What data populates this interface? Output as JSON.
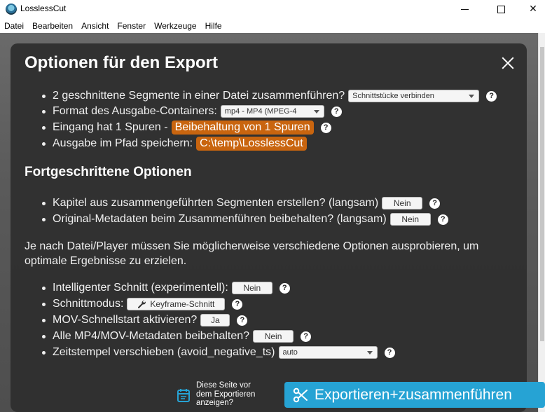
{
  "app": {
    "title": "LosslessCut"
  },
  "window_controls": {
    "minimize": "",
    "maximize": "",
    "close": "✕"
  },
  "menu": [
    "Datei",
    "Bearbeiten",
    "Ansicht",
    "Fenster",
    "Werkzeuge",
    "Hilfe"
  ],
  "dialog": {
    "title": "Optionen für den Export",
    "rows": {
      "merge": {
        "label": "2 geschnittene Segmente in einer Datei zusammenführen?",
        "value": "Schnittstücke verbinden"
      },
      "format": {
        "label": "Format des Ausgabe-Containers:",
        "value": "mp4 - MP4 (MPEG-4"
      },
      "input": {
        "label": "Eingang hat 1 Spuren -",
        "value": "Beibehaltung von 1 Spuren"
      },
      "path": {
        "label": "Ausgabe im Pfad speichern:",
        "value": "C:\\temp\\LosslessCut"
      }
    },
    "advanced": {
      "heading": "Fortgeschrittene Optionen",
      "chapters": {
        "label": "Kapitel aus zusammengeführten Segmenten erstellen? (langsam)",
        "value": "Nein"
      },
      "metadata": {
        "label": "Original-Metadaten beim Zusammenführen beibehalten? (langsam)",
        "value": "Nein"
      }
    },
    "note": "Je nach Datei/Player müssen Sie möglicherweise verschiedene Optionen ausprobieren, um optimale Ergebnisse zu erzielen.",
    "more": {
      "smartcut": {
        "label": "Intelligenter Schnitt (experimentell):",
        "value": "Nein"
      },
      "cutmode": {
        "label": "Schnittmodus:",
        "value": "Keyframe-Schnitt"
      },
      "movfast": {
        "label": "MOV-Schnellstart aktivieren?",
        "value": "Ja"
      },
      "allmeta": {
        "label": "Alle MP4/MOV-Metadaten beibehalten?",
        "value": "Nein"
      },
      "timestamps": {
        "label": "Zeitstempel verschieben (avoid_negative_ts)",
        "value": "auto"
      }
    },
    "help": "?",
    "ask_again": {
      "line1": "Diese Seite vor",
      "line2": "dem Exportieren",
      "line3": "anzeigen?"
    },
    "export_button": "Exportieren+zusammenführen"
  },
  "colors": {
    "accent": "#26a3d4",
    "highlight": "#c9650f",
    "dialog_bg": "#303030"
  },
  "icons": {
    "app": "losslesscut-icon",
    "close": "close-icon",
    "help": "help-icon",
    "wrench": "wrench-icon",
    "calendar": "calendar-icon",
    "scissors": "scissors-icon"
  }
}
